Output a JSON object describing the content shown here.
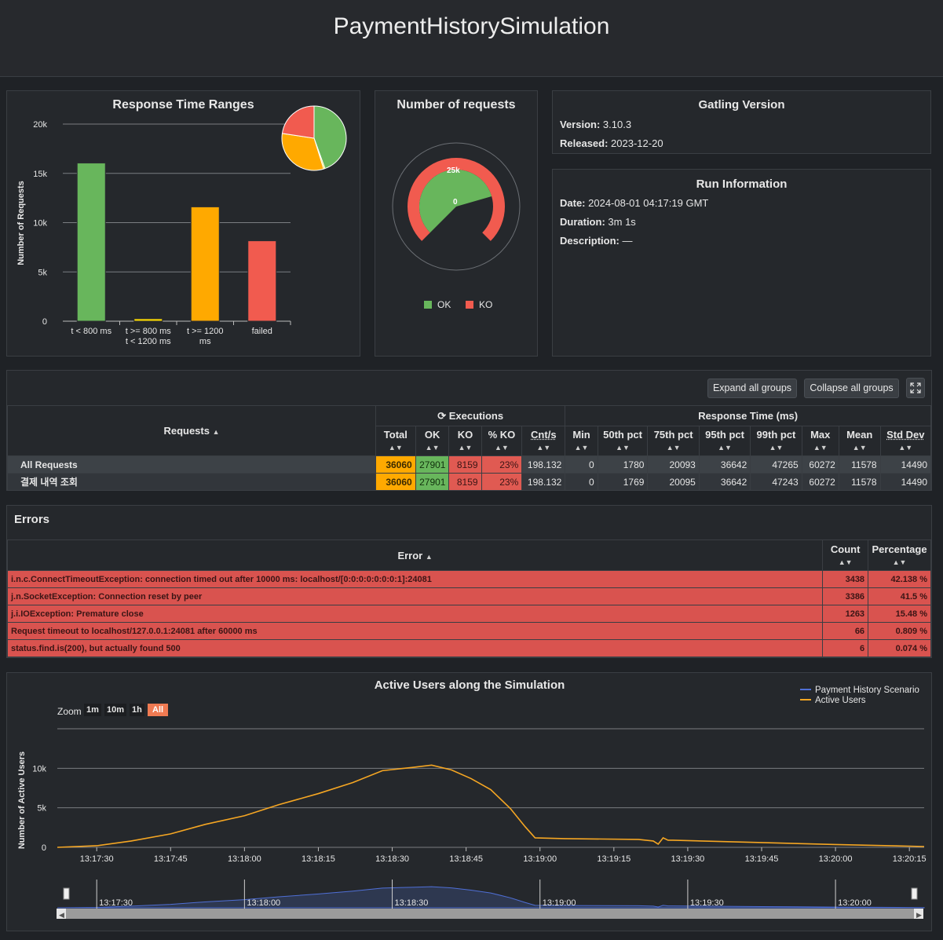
{
  "header": {
    "title": "PaymentHistorySimulation"
  },
  "response_time_ranges": {
    "title": "Response Time Ranges",
    "ylabel": "Number of Requests",
    "yticks": [
      "0",
      "5k",
      "10k",
      "15k",
      "20k"
    ],
    "categories": [
      "t < 800 ms",
      "t >= 800 ms\nt < 1200 ms",
      "t >= 1200\nms",
      "failed"
    ],
    "colors": {
      "ok_fast": "#68b65c",
      "ok_mid": "#ffdd00",
      "ok_slow": "#ffa900",
      "failed": "#f15b4f"
    }
  },
  "number_of_requests": {
    "title": "Number of requests",
    "gauge_label": "25k",
    "center_label": "0",
    "legend": [
      {
        "label": "OK",
        "color": "#68b65c"
      },
      {
        "label": "KO",
        "color": "#f15b4f"
      }
    ]
  },
  "gatling": {
    "title": "Gatling Version",
    "version_label": "Version:",
    "version": "3.10.3",
    "released_label": "Released:",
    "released": "2023-12-20"
  },
  "run_info": {
    "title": "Run Information",
    "date_label": "Date:",
    "date": "2024-08-01 04:17:19 GMT",
    "duration_label": "Duration:",
    "duration": "3m 1s",
    "description_label": "Description:",
    "description": "—"
  },
  "stats": {
    "expand_label": "Expand all groups",
    "collapse_label": "Collapse all groups",
    "requests_header": "Requests",
    "executions_header": "Executions",
    "response_time_header": "Response Time (ms)",
    "columns": [
      "Total",
      "OK",
      "KO",
      "% KO",
      "Cnt/s",
      "Min",
      "50th pct",
      "75th pct",
      "95th pct",
      "99th pct",
      "Max",
      "Mean",
      "Std Dev"
    ],
    "rows": [
      {
        "name": "All Requests",
        "values": [
          "36060",
          "27901",
          "8159",
          "23%",
          "198.132",
          "0",
          "1780",
          "20093",
          "36642",
          "47265",
          "60272",
          "11578",
          "14490"
        ]
      },
      {
        "name": "결제 내역 조회",
        "values": [
          "36060",
          "27901",
          "8159",
          "23%",
          "198.132",
          "0",
          "1769",
          "20095",
          "36642",
          "47243",
          "60272",
          "11578",
          "14490"
        ]
      }
    ]
  },
  "errors": {
    "title": "Errors",
    "col_error": "Error",
    "col_count": "Count",
    "col_percentage": "Percentage",
    "rows": [
      {
        "error": "i.n.c.ConnectTimeoutException: connection timed out after 10000 ms: localhost/[0:0:0:0:0:0:0:1]:24081",
        "count": "3438",
        "pct": "42.138 %"
      },
      {
        "error": "j.n.SocketException: Connection reset by peer",
        "count": "3386",
        "pct": "41.5 %"
      },
      {
        "error": "j.i.IOException: Premature close",
        "count": "1263",
        "pct": "15.48 %"
      },
      {
        "error": "Request timeout to localhost/127.0.0.1:24081 after 60000 ms",
        "count": "66",
        "pct": "0.809 %"
      },
      {
        "error": "status.find.is(200), but actually found 500",
        "count": "6",
        "pct": "0.074 %"
      }
    ]
  },
  "active_users": {
    "title": "Active Users along the Simulation",
    "ylabel": "Number of Active Users",
    "zoom_label": "Zoom",
    "zoom_options": [
      "1m",
      "10m",
      "1h",
      "All"
    ],
    "legend": [
      {
        "label": "Payment History Scenario",
        "color": "#4f6fd6"
      },
      {
        "label": "Active Users",
        "color": "#f5a623"
      }
    ],
    "yticks": [
      "0",
      "5k",
      "10k"
    ],
    "xticks": [
      "13:17:30",
      "13:17:45",
      "13:18:00",
      "13:18:15",
      "13:18:30",
      "13:18:45",
      "13:19:00",
      "13:19:15",
      "13:19:30",
      "13:19:45",
      "13:20:00",
      "13:20:15"
    ],
    "nav_ticks": [
      "13:17:30",
      "13:18:00",
      "13:18:30",
      "13:19:00",
      "13:19:30",
      "13:20:00"
    ]
  },
  "chart_data": [
    {
      "type": "bar",
      "title": "Response Time Ranges",
      "xlabel": "",
      "ylabel": "Number of Requests",
      "categories": [
        "t < 800 ms",
        "t >= 800 ms t < 1200 ms",
        "t >= 1200 ms",
        "failed"
      ],
      "values": [
        16050,
        250,
        11600,
        8159
      ],
      "ylim": [
        0,
        20000
      ],
      "grid": true
    },
    {
      "type": "pie",
      "categories": [
        "t < 800 ms",
        "t >= 800 ms t < 1200 ms",
        "t >= 1200 ms",
        "failed"
      ],
      "values": [
        16050,
        250,
        11600,
        8159
      ]
    },
    {
      "type": "line",
      "title": "Active Users along the Simulation",
      "ylabel": "Number of Active Users",
      "ylim": [
        0,
        15000
      ],
      "x": [
        "13:17:22",
        "13:17:30",
        "13:17:37",
        "13:17:45",
        "13:17:52",
        "13:18:00",
        "13:18:07",
        "13:18:15",
        "13:18:22",
        "13:18:28",
        "13:18:34",
        "13:18:38",
        "13:18:42",
        "13:18:46",
        "13:18:50",
        "13:18:54",
        "13:18:57",
        "13:18:59",
        "13:19:05",
        "13:19:20",
        "13:19:23",
        "13:19:24",
        "13:19:25",
        "13:19:26",
        "13:19:27",
        "13:19:45",
        "13:20:00",
        "13:20:15",
        "13:20:18"
      ],
      "series": [
        {
          "name": "Active Users",
          "values": [
            0,
            200,
            800,
            1700,
            2900,
            4000,
            5400,
            6800,
            8200,
            9700,
            10100,
            10400,
            9800,
            8700,
            7300,
            4900,
            2600,
            1200,
            1100,
            1000,
            800,
            400,
            1200,
            900,
            900,
            600,
            350,
            150,
            100
          ]
        }
      ]
    }
  ]
}
